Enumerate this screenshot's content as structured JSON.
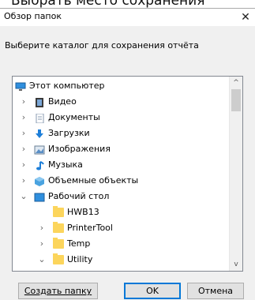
{
  "background_caption": "Выбрать место сохранения",
  "dialog": {
    "title": "Обзор папок",
    "close_label": "✕",
    "prompt": "Выберите каталог для сохранения отчёта"
  },
  "tree": {
    "items": [
      {
        "label": "Этот компьютер",
        "icon": "computer-icon",
        "chevron": "",
        "level": 0
      },
      {
        "label": "Видео",
        "icon": "video-icon",
        "chevron": "›",
        "level": 1
      },
      {
        "label": "Документы",
        "icon": "documents-icon",
        "chevron": "›",
        "level": 1
      },
      {
        "label": "Загрузки",
        "icon": "downloads-icon",
        "chevron": "›",
        "level": 1
      },
      {
        "label": "Изображения",
        "icon": "images-icon",
        "chevron": "›",
        "level": 1
      },
      {
        "label": "Музыка",
        "icon": "music-icon",
        "chevron": "›",
        "level": 1
      },
      {
        "label": "Объемные объекты",
        "icon": "3d-objects-icon",
        "chevron": "›",
        "level": 1
      },
      {
        "label": "Рабочий стол",
        "icon": "desktop-icon",
        "chevron": "⌄",
        "level": 1
      },
      {
        "label": "HWB13",
        "icon": "folder-icon",
        "chevron": "",
        "level": 2
      },
      {
        "label": "PrinterTool",
        "icon": "folder-icon",
        "chevron": "›",
        "level": 2
      },
      {
        "label": "Temp",
        "icon": "folder-icon",
        "chevron": "›",
        "level": 2
      },
      {
        "label": "Utility",
        "icon": "folder-icon",
        "chevron": "⌄",
        "level": 2
      }
    ]
  },
  "buttons": {
    "new_folder": "Создать папку",
    "ok": "OK",
    "cancel": "Отмена"
  },
  "scrollbar": {
    "up": "^",
    "down": "v"
  }
}
